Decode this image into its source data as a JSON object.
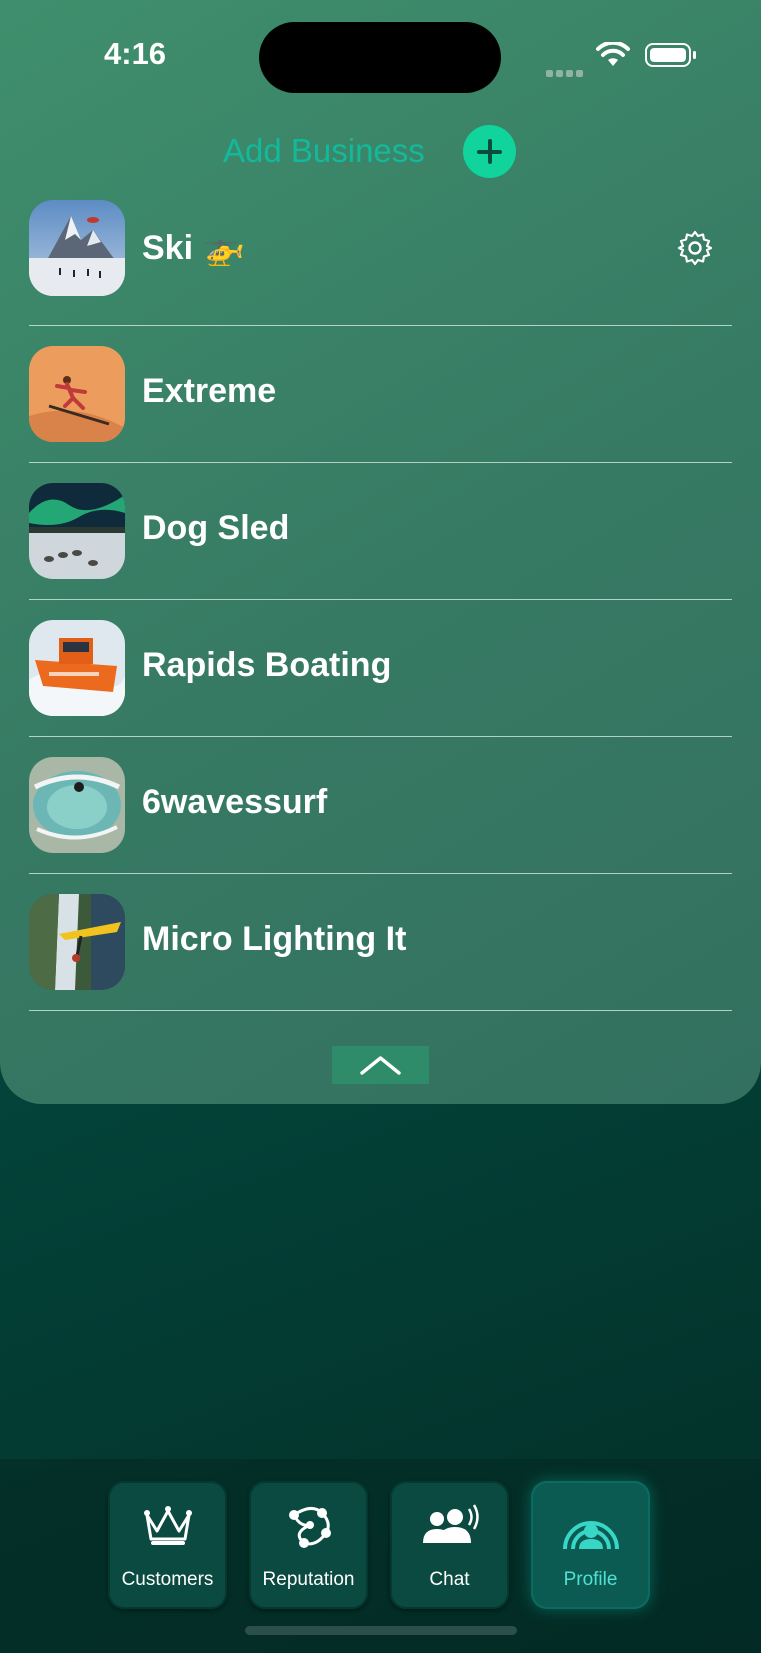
{
  "status_bar": {
    "time": "4:16"
  },
  "header": {
    "add_label": "Add Business"
  },
  "businesses": [
    {
      "name": "Ski 🚁",
      "thumb": "mountain-helicopter-ski"
    },
    {
      "name": "Extreme",
      "thumb": "sand-desert-board"
    },
    {
      "name": "Dog Sled",
      "thumb": "aurora-dog-sled"
    },
    {
      "name": "Rapids Boating",
      "thumb": "orange-jet-boat"
    },
    {
      "name": "6wavessurf",
      "thumb": "aerial-surf-wave"
    },
    {
      "name": "Micro Lighting It",
      "thumb": "microlight-over-falls"
    }
  ],
  "tabs": [
    {
      "label": "Customers",
      "icon": "crown-icon"
    },
    {
      "label": "Reputation",
      "icon": "network-icon"
    },
    {
      "label": "Chat",
      "icon": "people-speaking-icon"
    },
    {
      "label": "Profile",
      "icon": "profile-arc-icon",
      "active": true
    }
  ],
  "colors": {
    "accent": "#10d49c",
    "add_text": "#12b99a",
    "active_tab": "#4fe1d4"
  }
}
